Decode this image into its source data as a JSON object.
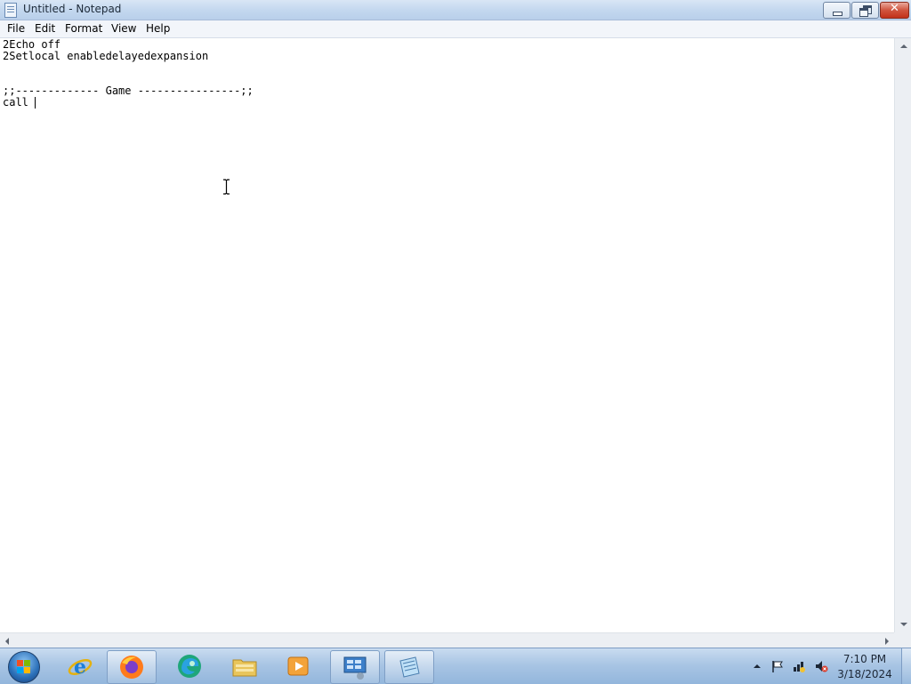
{
  "window": {
    "title": "Untitled - Notepad"
  },
  "menu": {
    "items": [
      "File",
      "Edit",
      "Format",
      "View",
      "Help"
    ]
  },
  "editor": {
    "lines": [
      "2Echo off",
      "2Setlocal enabledelayedexpansion",
      "",
      "",
      ";;------------- Game ----------------;;",
      "call "
    ]
  },
  "taskbar": {
    "apps": [
      {
        "name": "Internet Explorer",
        "icon": "internet-explorer-icon",
        "running": false
      },
      {
        "name": "Firefox",
        "icon": "firefox-icon",
        "running": true
      },
      {
        "name": "Edge",
        "icon": "edge-icon",
        "running": false
      },
      {
        "name": "Windows Explorer",
        "icon": "folder-icon",
        "running": false
      },
      {
        "name": "Media Player",
        "icon": "media-player-icon",
        "running": false
      },
      {
        "name": "Remote Desktop",
        "icon": "remote-desktop-icon",
        "running": true
      },
      {
        "name": "Notepad",
        "icon": "notepad-icon",
        "running": true
      }
    ],
    "clock_time": "7:10 PM",
    "clock_date": "3/18/2024"
  }
}
